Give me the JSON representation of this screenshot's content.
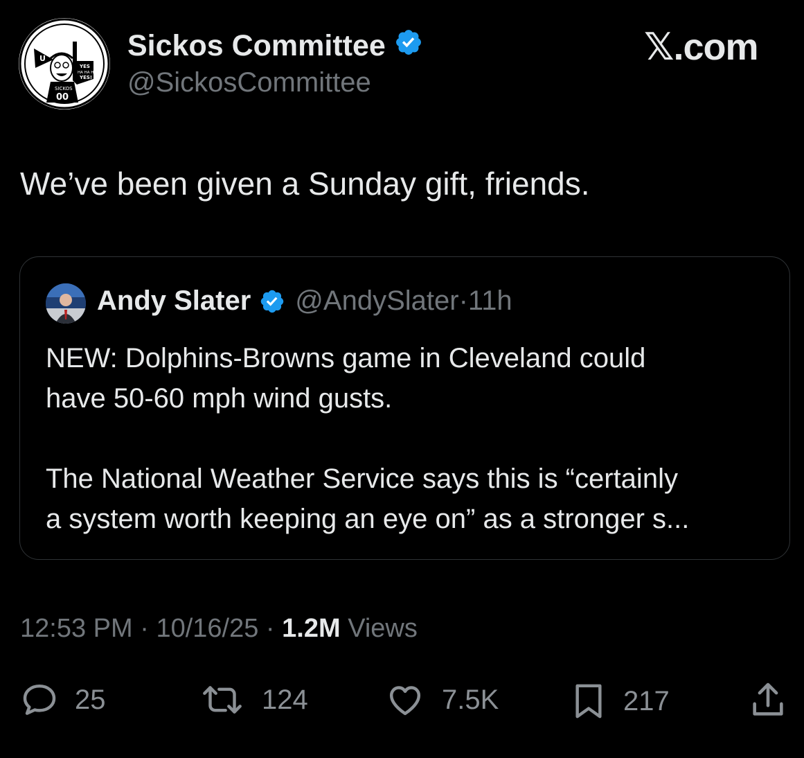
{
  "account": {
    "name": "Sickos Committee",
    "handle": "@SickosCommittee"
  },
  "brand": "𝕏.com",
  "tweet": {
    "text": "We’ve been given a Sunday gift, friends.",
    "time": "12:53 PM",
    "date": "10/16/25",
    "views_count": "1.2M",
    "views_label": "Views",
    "separator": " · "
  },
  "quote": {
    "name": "Andy Slater",
    "handle": "@AndySlater",
    "time": "11h",
    "paragraph1": "NEW: Dolphins-Browns game in Cleveland could have 50-60 mph wind gusts.",
    "paragraph1_line1": "NEW: Dolphins-Browns game in Cleveland could",
    "paragraph1_line2": "have 50-60 mph wind gusts.",
    "paragraph2_line1": "The National Weather Service says this is “certainly",
    "paragraph2_line2": "a system worth keeping an eye on” as a stronger s..."
  },
  "actions": {
    "replies": "25",
    "reposts": "124",
    "likes": "7.5K",
    "bookmarks": "217"
  },
  "avatar_text": {
    "sign": "YES HA HA HA YES!",
    "jersey_name": "SICKOS",
    "jersey_number": "00"
  },
  "colors": {
    "background": "#000000",
    "text": "#e7e9ea",
    "muted": "#71767b",
    "verified": "#1d9bf0",
    "border": "#2f3336"
  },
  "icons": [
    "verified-badge-icon",
    "reply-icon",
    "repost-icon",
    "like-icon",
    "bookmark-icon",
    "share-icon"
  ]
}
